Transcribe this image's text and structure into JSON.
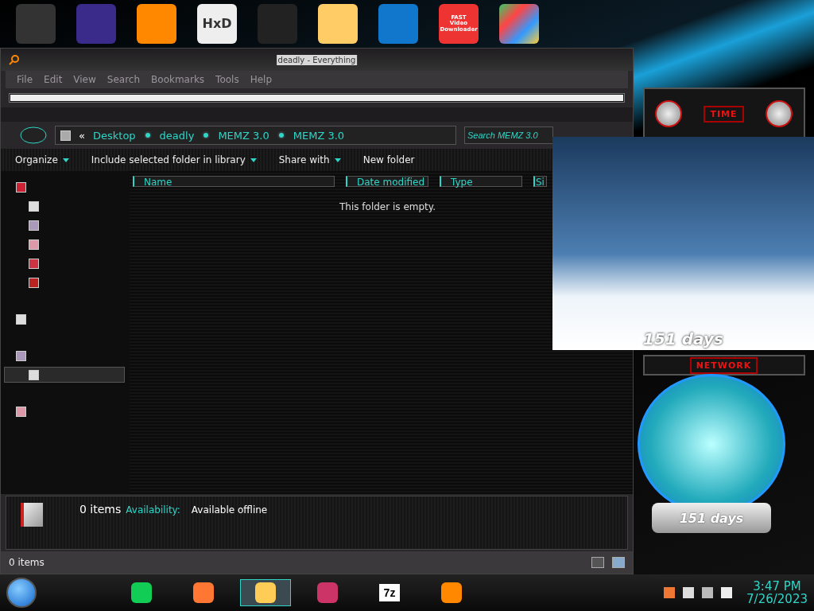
{
  "desktop_icons": [
    {
      "kind": "tools"
    },
    {
      "kind": "firefox-dev"
    },
    {
      "kind": "cone"
    },
    {
      "kind": "hex",
      "label": "HxD"
    },
    {
      "kind": "chart"
    },
    {
      "kind": "cartoon"
    },
    {
      "kind": "shield"
    },
    {
      "kind": "video",
      "lines": [
        "FAST",
        "Video",
        "Downloader"
      ]
    },
    {
      "kind": "tiles"
    }
  ],
  "window": {
    "title": "deadly - Everything",
    "menu": [
      "File",
      "Edit",
      "View",
      "Search",
      "Bookmarks",
      "Tools",
      "Help"
    ],
    "progress": {
      "level": 1
    }
  },
  "address": {
    "back": "«",
    "crumbs": [
      "Desktop",
      "deadly",
      "MEMZ 3.0",
      "MEMZ 3.0"
    ],
    "search_placeholder": "Search MEMZ 3.0"
  },
  "toolbar": [
    {
      "label": "Organize",
      "dropdown": true
    },
    {
      "label": "Include selected folder in library",
      "dropdown": true
    },
    {
      "label": "Share with",
      "dropdown": true
    },
    {
      "label": "New folder",
      "dropdown": false
    }
  ],
  "sidebar": [
    {
      "selected": false,
      "children": [
        {
          "selected": false
        },
        {
          "selected": false
        },
        {
          "selected": false
        },
        {
          "selected": false
        },
        {
          "selected": false
        }
      ]
    },
    {
      "selected": false
    },
    {
      "selected": false,
      "children": [
        {
          "selected": true
        }
      ]
    },
    {
      "selected": false
    }
  ],
  "columns": [
    "Name",
    "Date modified",
    "Type",
    "Si"
  ],
  "empty_message": "This folder is empty.",
  "details": {
    "count": "0 items",
    "availability_label": "Availability:",
    "availability_value": "Available offline"
  },
  "status_bar": {
    "text": "0 items"
  },
  "widgets": {
    "time_title": "TIME",
    "network_title": "NETWORK",
    "winter_days": "151 days",
    "globe_days": "151 days"
  },
  "taskbar": {
    "apps": [
      {
        "kind": "notes",
        "selected": false
      },
      {
        "kind": "firefox",
        "selected": false
      },
      {
        "kind": "explorer",
        "selected": true
      },
      {
        "kind": "display",
        "selected": false
      },
      {
        "kind": "zip",
        "label": "7z",
        "selected": false
      },
      {
        "kind": "search",
        "selected": false
      }
    ],
    "time": "3:47 PM",
    "date": "7/26/2023"
  }
}
